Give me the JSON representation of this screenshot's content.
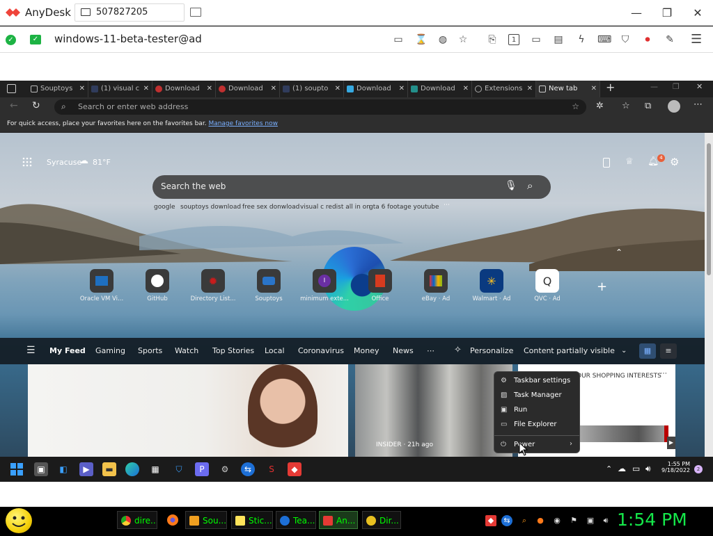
{
  "anydesk": {
    "app_name": "AnyDesk",
    "address_id": "507827205",
    "session_name": "windows-11-beta-tester@ad",
    "brand_color": "#ef443b"
  },
  "edge": {
    "tabs": [
      {
        "label": "Souptoys"
      },
      {
        "label": "(1) visual c"
      },
      {
        "label": "Download"
      },
      {
        "label": "Download"
      },
      {
        "label": "(1) soupto"
      },
      {
        "label": "Download"
      },
      {
        "label": "Download"
      },
      {
        "label": "Extensions"
      },
      {
        "label": "New tab"
      }
    ],
    "address_placeholder": "Search or enter web address",
    "favbar_text": "For quick access, place your favorites here on the favorites bar.",
    "favbar_link": "Manage favorites now"
  },
  "ntp": {
    "city": "Syracuse",
    "temperature": "81°F",
    "notification_count": "4",
    "search_placeholder": "Search the web",
    "suggestions": [
      "google",
      "souptoys download",
      "free sex donwload",
      "visual c redist all in on",
      "gta 6 footage youtube"
    ],
    "tiles": [
      {
        "label": "Oracle VM Vi..."
      },
      {
        "label": "GitHub"
      },
      {
        "label": "Directory List..."
      },
      {
        "label": "Souptoys"
      },
      {
        "label": "minimum exte..."
      },
      {
        "label": "Office"
      },
      {
        "label": "eBay · Ad"
      },
      {
        "label": "Walmart · Ad"
      },
      {
        "label": "QVC · Ad"
      }
    ],
    "feed_tabs": [
      "My Feed",
      "Gaming",
      "Sports",
      "Watch",
      "Top Stories",
      "Local",
      "Coronavirus",
      "Money",
      "News"
    ],
    "personalize": "Personalize",
    "content_visibility": "Content partially visible",
    "card2_source": "INSIDER · 21h ago",
    "card3_header": "OUR SHOPPING INTERESTS"
  },
  "context_menu": {
    "items": [
      "Taskbar settings",
      "Task Manager",
      "Run",
      "File Explorer",
      "Power"
    ]
  },
  "remote_taskbar": {
    "time": "1:55 PM",
    "date": "9/18/2022",
    "badge": "2"
  },
  "host_taskbar": {
    "buttons": [
      {
        "label": "dire..."
      },
      {
        "label": "Sou..."
      },
      {
        "label": "Stic..."
      },
      {
        "label": "Tea..."
      },
      {
        "label": "An..."
      },
      {
        "label": "Dir..."
      }
    ],
    "clock": "1:54 PM"
  }
}
